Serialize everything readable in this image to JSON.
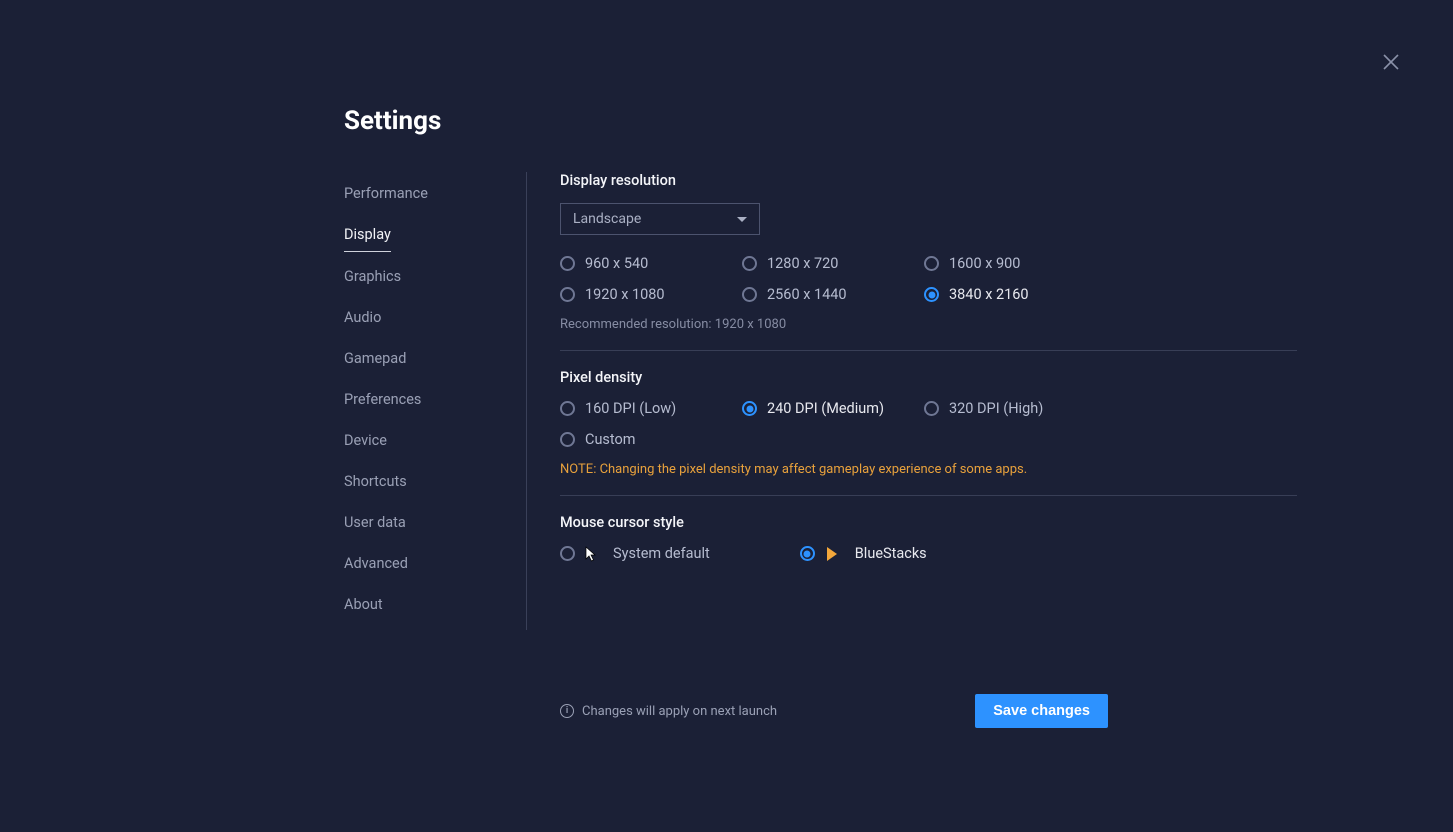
{
  "title": "Settings",
  "sidebar": {
    "items": [
      {
        "label": "Performance",
        "active": false
      },
      {
        "label": "Display",
        "active": true
      },
      {
        "label": "Graphics",
        "active": false
      },
      {
        "label": "Audio",
        "active": false
      },
      {
        "label": "Gamepad",
        "active": false
      },
      {
        "label": "Preferences",
        "active": false
      },
      {
        "label": "Device",
        "active": false
      },
      {
        "label": "Shortcuts",
        "active": false
      },
      {
        "label": "User data",
        "active": false
      },
      {
        "label": "Advanced",
        "active": false
      },
      {
        "label": "About",
        "active": false
      }
    ]
  },
  "resolution": {
    "heading": "Display resolution",
    "orientation": "Landscape",
    "options": [
      {
        "label": "960 x 540",
        "selected": false
      },
      {
        "label": "1280 x 720",
        "selected": false
      },
      {
        "label": "1600 x 900",
        "selected": false
      },
      {
        "label": "1920 x 1080",
        "selected": false
      },
      {
        "label": "2560 x 1440",
        "selected": false
      },
      {
        "label": "3840 x 2160",
        "selected": true
      }
    ],
    "recommended": "Recommended resolution: 1920 x 1080"
  },
  "density": {
    "heading": "Pixel density",
    "options": [
      {
        "label": "160 DPI (Low)",
        "selected": false
      },
      {
        "label": "240 DPI (Medium)",
        "selected": true
      },
      {
        "label": "320 DPI (High)",
        "selected": false
      },
      {
        "label": "Custom",
        "selected": false
      }
    ],
    "note": "NOTE: Changing the pixel density may affect gameplay experience of some apps."
  },
  "cursor": {
    "heading": "Mouse cursor style",
    "options": [
      {
        "label": "System default",
        "selected": false
      },
      {
        "label": "BlueStacks",
        "selected": true
      }
    ]
  },
  "footer": {
    "info": "Changes will apply on next launch",
    "save": "Save changes"
  }
}
